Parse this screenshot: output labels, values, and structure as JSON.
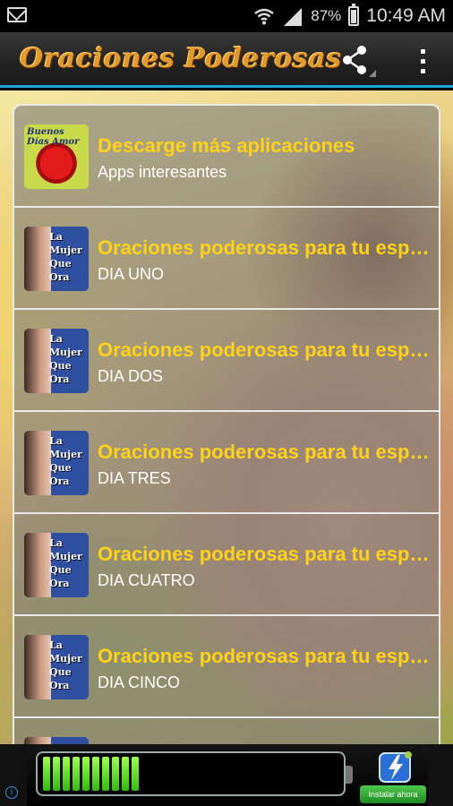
{
  "status_bar": {
    "battery": "87%",
    "time": "10:49 AM",
    "icons": [
      "gmail-icon",
      "wifi-icon",
      "signal-icon",
      "battery-icon"
    ]
  },
  "action_bar": {
    "title": "Oraciones Poderosas",
    "icons": [
      "share-icon",
      "overflow-menu-icon"
    ]
  },
  "list": {
    "items": [
      {
        "title": "Descarge más aplicaciones",
        "subtitle": "Apps interesantes",
        "thumb": "heart-icon",
        "thumb_text": "Buenos Días Amor"
      },
      {
        "title": "Oraciones poderosas para tu esposo",
        "subtitle": "DIA UNO",
        "thumb": "praying-woman-icon",
        "thumb_lines": [
          "La",
          "Mujer",
          "Que",
          "Ora"
        ]
      },
      {
        "title": "Oraciones poderosas para tu esposo",
        "subtitle": "DIA DOS",
        "thumb": "praying-woman-icon",
        "thumb_lines": [
          "La",
          "Mujer",
          "Que",
          "Ora"
        ]
      },
      {
        "title": "Oraciones poderosas para tu esposo",
        "subtitle": "DIA TRES",
        "thumb": "praying-woman-icon",
        "thumb_lines": [
          "La",
          "Mujer",
          "Que",
          "Ora"
        ]
      },
      {
        "title": "Oraciones poderosas para tu esposo",
        "subtitle": "DIA CUATRO",
        "thumb": "praying-woman-icon",
        "thumb_lines": [
          "La",
          "Mujer",
          "Que",
          "Ora"
        ]
      },
      {
        "title": "Oraciones poderosas para tu esposo",
        "subtitle": "DIA CINCO",
        "thumb": "praying-woman-icon",
        "thumb_lines": [
          "La",
          "Mujer",
          "Que",
          "Ora"
        ]
      }
    ]
  },
  "ad": {
    "install_label": "Instalar ahora",
    "battery_charge": 0.32,
    "icons": [
      "battery-charge-icon",
      "ad-info-icon",
      "app-lightning-icon"
    ]
  },
  "colors": {
    "accent": "#1aa6d8",
    "item_title": "#ffd21a",
    "app_title": "#e29a2a"
  }
}
